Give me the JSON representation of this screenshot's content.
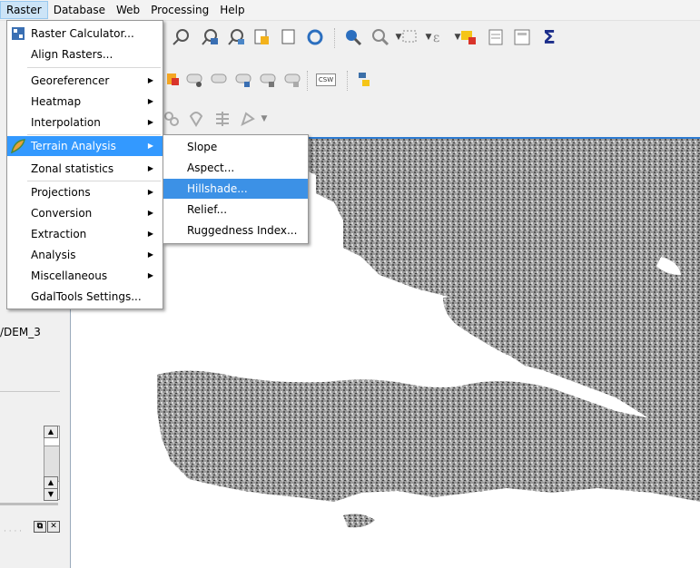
{
  "menubar": {
    "items": [
      {
        "label": "Raster"
      },
      {
        "label": "Database"
      },
      {
        "label": "Web"
      },
      {
        "label": "Processing"
      },
      {
        "label": "Help"
      }
    ]
  },
  "raster_menu": {
    "items": [
      {
        "label": "Raster Calculator..."
      },
      {
        "label": "Align Rasters..."
      },
      {
        "label": "Georeferencer"
      },
      {
        "label": "Heatmap"
      },
      {
        "label": "Interpolation"
      },
      {
        "label": "Terrain Analysis"
      },
      {
        "label": "Zonal statistics"
      },
      {
        "label": "Projections"
      },
      {
        "label": "Conversion"
      },
      {
        "label": "Extraction"
      },
      {
        "label": "Analysis"
      },
      {
        "label": "Miscellaneous"
      },
      {
        "label": "GdalTools Settings..."
      }
    ]
  },
  "terrain_submenu": {
    "items": [
      {
        "label": "Slope"
      },
      {
        "label": "Aspect..."
      },
      {
        "label": "Hillshade..."
      },
      {
        "label": "Relief..."
      },
      {
        "label": "Ruggedness Index..."
      }
    ]
  },
  "layers_panel": {
    "layer_label": "/DEM_3"
  },
  "toolbar": {
    "csw_label": "CSW"
  },
  "colors": {
    "highlight": "#3399ff",
    "canvas_border": "#2d7bd1",
    "terrain": "#8c8c8c"
  }
}
